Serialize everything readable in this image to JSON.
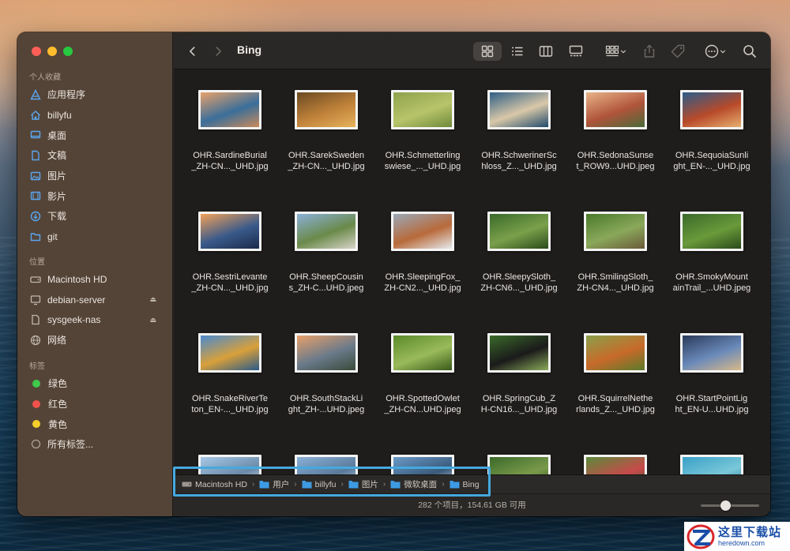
{
  "window": {
    "title": "Bing"
  },
  "sidebar": {
    "favorites_heading": "个人收藏",
    "favorites": [
      {
        "label": "应用程序",
        "icon": "applications-icon"
      },
      {
        "label": "billyfu",
        "icon": "home-icon"
      },
      {
        "label": "桌面",
        "icon": "desktop-icon"
      },
      {
        "label": "文稿",
        "icon": "document-icon"
      },
      {
        "label": "图片",
        "icon": "pictures-icon"
      },
      {
        "label": "影片",
        "icon": "movies-icon"
      },
      {
        "label": "下载",
        "icon": "downloads-icon"
      },
      {
        "label": "git",
        "icon": "folder-icon"
      }
    ],
    "locations_heading": "位置",
    "locations": [
      {
        "label": "Macintosh HD",
        "icon": "hard-drive-icon"
      },
      {
        "label": "debian-server",
        "icon": "server-icon"
      },
      {
        "label": "sysgeek-nas",
        "icon": "nas-icon"
      },
      {
        "label": "网络",
        "icon": "network-icon"
      }
    ],
    "tags_heading": "标签",
    "tags": [
      {
        "label": "绿色",
        "color": "#3fc94a"
      },
      {
        "label": "红色",
        "color": "#f0524b"
      },
      {
        "label": "黄色",
        "color": "#f6cf2a"
      },
      {
        "label": "所有标签..."
      }
    ]
  },
  "files": [
    {
      "line1": "OHR.SardineBurial",
      "line2": "_ZH-CN..._UHD.jpg",
      "colors": [
        "#e9a26a",
        "#3a6e9a",
        "#c98a5a"
      ]
    },
    {
      "line1": "OHR.SarekSweden",
      "line2": "_ZH-CN..._UHD.jpg",
      "colors": [
        "#6b4a22",
        "#c0823a",
        "#e6b25c"
      ]
    },
    {
      "line1": "OHR.Schmetterling",
      "line2": "swiese_..._UHD.jpg",
      "colors": [
        "#8ea24c",
        "#b8c46a",
        "#6e8a3a"
      ]
    },
    {
      "line1": "OHR.SchwerinerSc",
      "line2": "hloss_Z..._UHD.jpg",
      "colors": [
        "#2f5f86",
        "#d9c8a8",
        "#1f4a6a"
      ]
    },
    {
      "line1": "OHR.SedonaSunse",
      "line2": "t_ROW9...UHD.jpeg",
      "colors": [
        "#e8b488",
        "#b0543a",
        "#4a6a3a"
      ]
    },
    {
      "line1": "OHR.SequoiaSunli",
      "line2": "ght_EN-..._UHD.jpg",
      "colors": [
        "#2a5c8a",
        "#b84a2a",
        "#e6b070"
      ]
    },
    {
      "line1": "OHR.SestriLevante",
      "line2": "_ZH-CN..._UHD.jpg",
      "colors": [
        "#f2a25a",
        "#3a5a8a",
        "#1a2a4a"
      ]
    },
    {
      "line1": "OHR.SheepCousin",
      "line2": "s_ZH-C...UHD.jpeg",
      "colors": [
        "#8ab0d8",
        "#6a8a4a",
        "#d8d4c8"
      ]
    },
    {
      "line1": "OHR.SleepingFox_",
      "line2": "ZH-CN2..._UHD.jpg",
      "colors": [
        "#9aa8b8",
        "#b86a3a",
        "#e6eaee"
      ]
    },
    {
      "line1": "OHR.SleepySloth_",
      "line2": "ZH-CN6..._UHD.jpg",
      "colors": [
        "#3a6a2a",
        "#7aa04a",
        "#2a4a1a"
      ]
    },
    {
      "line1": "OHR.SmilingSloth_",
      "line2": "ZH-CN4..._UHD.jpg",
      "colors": [
        "#4a7a2a",
        "#8aa85a",
        "#6a5a3a"
      ]
    },
    {
      "line1": "OHR.SmokyMount",
      "line2": "ainTrail_...UHD.jpeg",
      "colors": [
        "#3a6a2a",
        "#6a9a3a",
        "#2a4a1a"
      ]
    },
    {
      "line1": "OHR.SnakeRiverTe",
      "line2": "ton_EN-..._UHD.jpg",
      "colors": [
        "#4a8ad0",
        "#d8a03a",
        "#2a5a8a"
      ]
    },
    {
      "line1": "OHR.SouthStackLi",
      "line2": "ght_ZH-...UHD.jpeg",
      "colors": [
        "#e8a06a",
        "#6a7a8a",
        "#3a4a3a"
      ]
    },
    {
      "line1": "OHR.SpottedOwlet",
      "line2": "_ZH-CN...UHD.jpeg",
      "colors": [
        "#5a8a2a",
        "#9aba5a",
        "#3a5a1a"
      ]
    },
    {
      "line1": "OHR.SpringCub_Z",
      "line2": "H-CN16..._UHD.jpg",
      "colors": [
        "#3a6a2a",
        "#1a1a1a",
        "#8aaa5a"
      ]
    },
    {
      "line1": "OHR.SquirrelNethe",
      "line2": "rlands_Z..._UHD.jpg",
      "colors": [
        "#8aa04a",
        "#c86a2a",
        "#5a7a2a"
      ]
    },
    {
      "line1": "OHR.StartPointLig",
      "line2": "ht_EN-U...UHD.jpg",
      "colors": [
        "#2a3a5a",
        "#6a8aba",
        "#d8b888"
      ]
    },
    {
      "line1": "",
      "line2": "",
      "colors": [
        "#a8c8e8",
        "#6a8aa8",
        "#e8e8e8"
      ]
    },
    {
      "line1": "",
      "line2": "",
      "colors": [
        "#8ab0d8",
        "#5a7a9a",
        "#c8d8e8"
      ]
    },
    {
      "line1": "",
      "line2": "",
      "colors": [
        "#6a9ac8",
        "#3a5a7a",
        "#d8e0e8"
      ]
    },
    {
      "line1": "",
      "line2": "",
      "colors": [
        "#3a6a2a",
        "#7a9a4a",
        "#2a4a1a"
      ]
    },
    {
      "line1": "",
      "line2": "",
      "colors": [
        "#5a8a3a",
        "#c84a4a",
        "#3a5a2a"
      ]
    },
    {
      "line1": "",
      "line2": "",
      "colors": [
        "#3aa0c8",
        "#7ac8d8",
        "#1a6a8a"
      ]
    }
  ],
  "pathbar": {
    "crumbs": [
      {
        "label": "Macintosh HD",
        "icon": "hard-drive-icon"
      },
      {
        "label": "用户",
        "icon": "folder-icon"
      },
      {
        "label": "billyfu",
        "icon": "folder-icon"
      },
      {
        "label": "图片",
        "icon": "folder-icon"
      },
      {
        "label": "微软桌面",
        "icon": "folder-icon"
      },
      {
        "label": "Bing",
        "icon": "folder-icon"
      }
    ]
  },
  "status": {
    "text": "282 个项目，154.61 GB 可用"
  },
  "watermark": {
    "title": "这里下载站",
    "subtitle": "heredown.com"
  }
}
